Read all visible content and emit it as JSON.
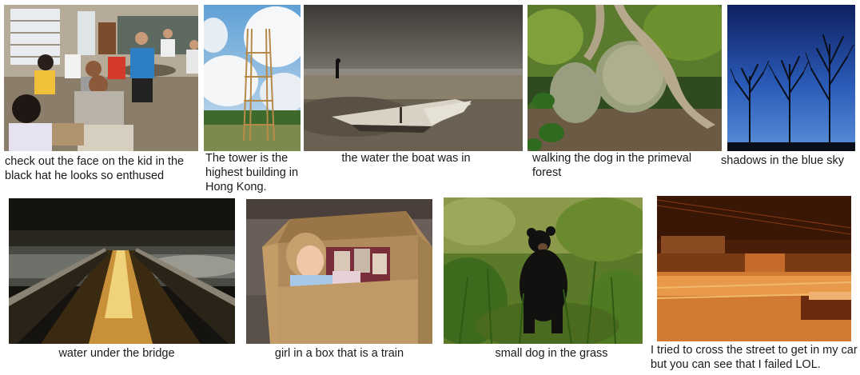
{
  "row1": [
    {
      "image": "classroom-photo",
      "caption": "check out the face on the kid in the black hat he looks so enthused"
    },
    {
      "image": "tower-photo",
      "caption": "The tower is the highest building in Hong Kong."
    },
    {
      "image": "beach-boat-photo",
      "caption": "the water the boat was in"
    },
    {
      "image": "forest-tree-rocks-photo",
      "caption": "walking the dog in the primeval forest"
    },
    {
      "image": "trees-blue-sky-photo",
      "caption": "shadows in the blue sky"
    }
  ],
  "row2": [
    {
      "image": "bridge-water-photo",
      "caption": "water under the bridge"
    },
    {
      "image": "girl-in-box-photo",
      "caption": "girl in a box that is a train"
    },
    {
      "image": "bear-cub-grass-photo",
      "caption": "small dog in the grass"
    },
    {
      "image": "snowy-street-night-photo",
      "caption": "I tried to cross the street to get in my car but you can see that I failed LOL."
    }
  ]
}
